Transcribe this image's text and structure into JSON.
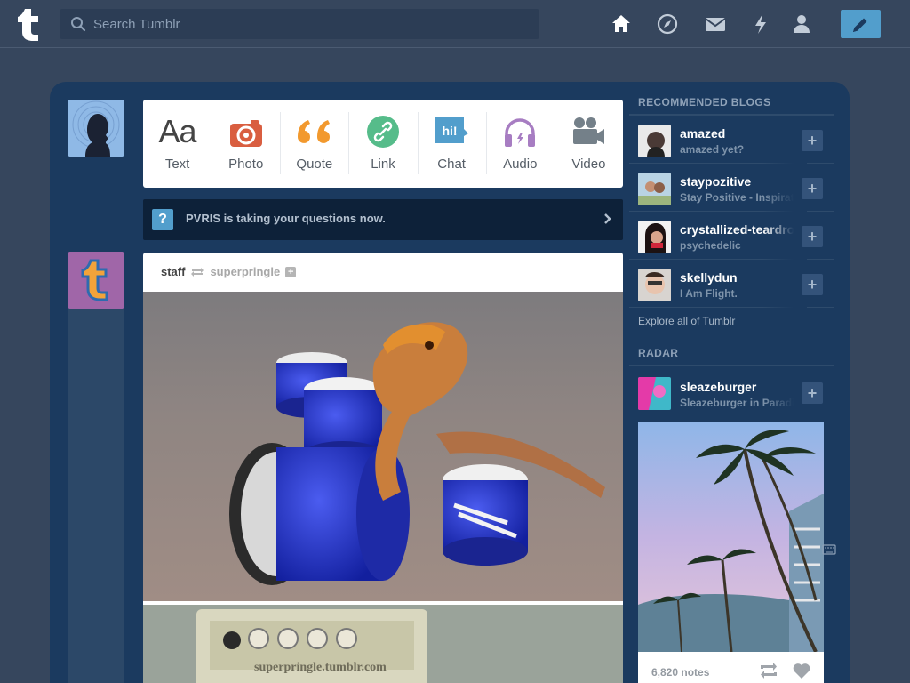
{
  "header": {
    "search": {
      "placeholder": "Search Tumblr"
    },
    "nav": [
      "home-icon",
      "explore-compass-icon",
      "inbox-mail-icon",
      "activity-lightning-icon",
      "account-person-icon"
    ],
    "compose": "pencil-icon"
  },
  "post_types": [
    {
      "label": "Text",
      "icon": "text-aa-icon",
      "color": "#444444"
    },
    {
      "label": "Photo",
      "icon": "camera-icon",
      "color": "#d95e40"
    },
    {
      "label": "Quote",
      "icon": "quote-icon",
      "color": "#f2992e"
    },
    {
      "label": "Link",
      "icon": "link-icon",
      "color": "#56bc8a"
    },
    {
      "label": "Chat",
      "icon": "chat-bubble-icon",
      "color": "#529ecc"
    },
    {
      "label": "Audio",
      "icon": "headphones-icon",
      "color": "#a77dc2"
    },
    {
      "label": "Video",
      "icon": "video-camera-icon",
      "color": "#748089"
    }
  ],
  "banner": {
    "text": "PVRIS is taking your questions now."
  },
  "post": {
    "author": "staff",
    "reblogged_from": "superpringle",
    "watermark_1": "superpringle.tumblr.com",
    "watermark_2": "superpringle.tumblr.com"
  },
  "sidebar": {
    "recommended_title": "RECOMMENDED BLOGS",
    "blogs": [
      {
        "name": "amazed",
        "desc": "amazed yet?"
      },
      {
        "name": "staypozitive",
        "desc": "Stay Positive - Inspiration"
      },
      {
        "name": "crystallized-teardrops",
        "desc": "psychedelic"
      },
      {
        "name": "skellydun",
        "desc": "I Am Flight."
      }
    ],
    "explore": "Explore all of Tumblr",
    "radar_title": "RADAR",
    "radar": {
      "name": "sleazeburger",
      "desc": "Sleazeburger in Paradise",
      "notes": "6,820 notes"
    }
  }
}
